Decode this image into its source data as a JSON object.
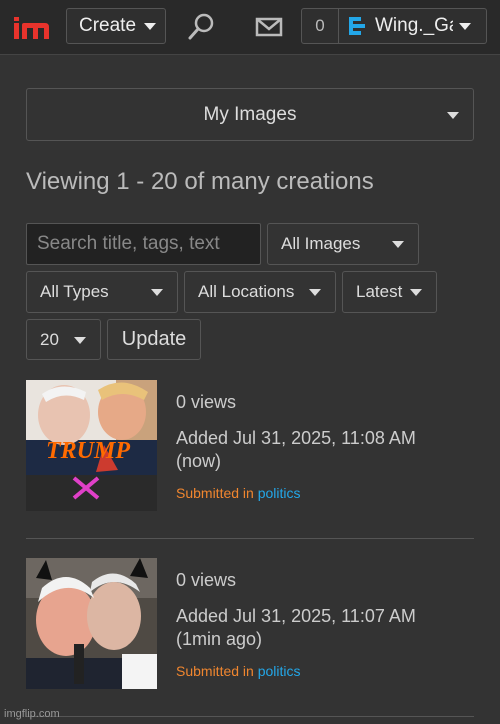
{
  "header": {
    "create_label": "Create",
    "notif_count": "0",
    "username": "Wing._Ga"
  },
  "main": {
    "filter_dropdown": "My Images",
    "viewing_text": "Viewing 1 - 20 of many creations",
    "search_placeholder": "Search title, tags, text",
    "image_filter": "All Images",
    "type_filter": "All Types",
    "location_filter": "All Locations",
    "sort_filter": "Latest",
    "count_filter": "20",
    "update_label": "Update"
  },
  "items": [
    {
      "views": "0 views",
      "added": "Added Jul 31, 2025, 11:08 AM",
      "relative": "(now)",
      "submitted_prefix": "Submitted in",
      "stream": "politics",
      "thumb_text": "TRUMP"
    },
    {
      "views": "0 views",
      "added": "Added Jul 31, 2025, 11:07 AM",
      "relative": "(1min ago)",
      "submitted_prefix": "Submitted in",
      "stream": "politics"
    }
  ],
  "footer": {
    "watermark": "imgflip.com"
  },
  "colors": {
    "background": "#333333",
    "accent_orange": "#f0862f",
    "link_blue": "#23a7e8",
    "logo_red": "#e8332c"
  }
}
